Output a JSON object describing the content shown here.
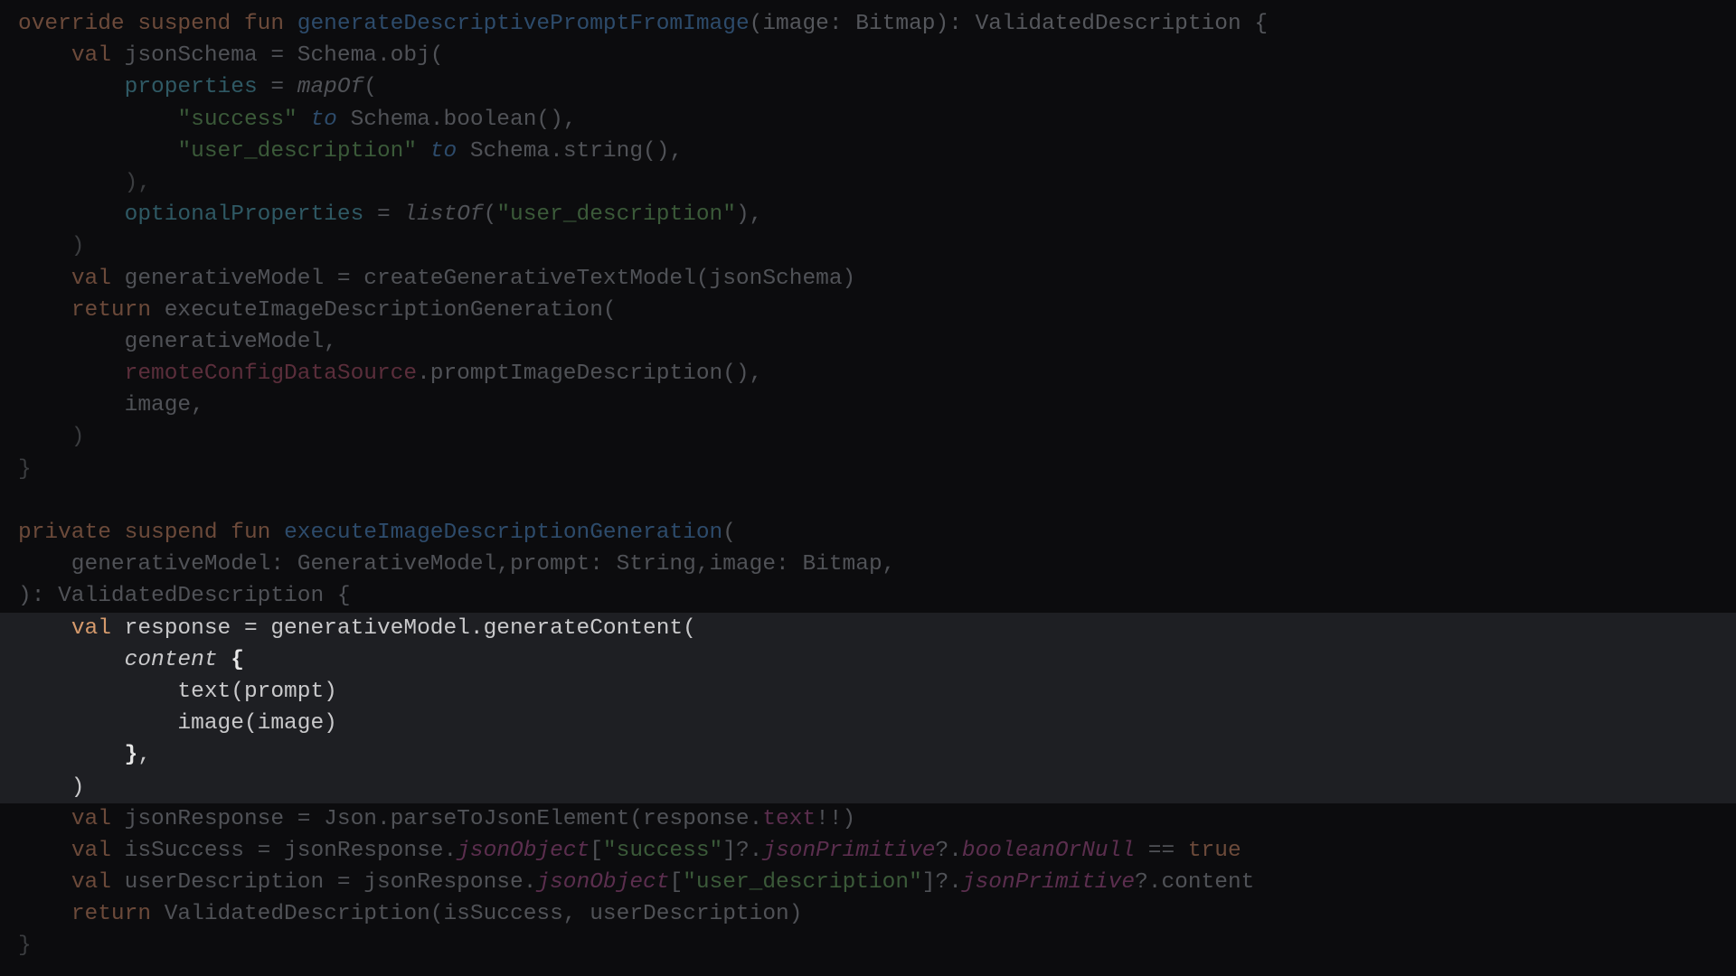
{
  "editor": {
    "lines": [
      {
        "highlighted": false,
        "tokens": [
          {
            "t": "override suspend fun ",
            "c": "kw"
          },
          {
            "t": "generateDescriptivePromptFromImage",
            "c": "fn"
          },
          {
            "t": "(image: Bitmap): ValidatedDescription {",
            "c": "tp"
          }
        ]
      },
      {
        "highlighted": false,
        "tokens": [
          {
            "t": "    ",
            "c": "plain"
          },
          {
            "t": "val ",
            "c": "kw"
          },
          {
            "t": "jsonSchema = Schema.obj(",
            "c": "plain"
          }
        ]
      },
      {
        "highlighted": false,
        "tokens": [
          {
            "t": "        ",
            "c": "plain"
          },
          {
            "t": "properties",
            "c": "pr"
          },
          {
            "t": " = ",
            "c": "plain"
          },
          {
            "t": "mapOf",
            "c": "plain it"
          },
          {
            "t": "(",
            "c": "plain"
          }
        ]
      },
      {
        "highlighted": false,
        "tokens": [
          {
            "t": "            ",
            "c": "plain"
          },
          {
            "t": "\"success\"",
            "c": "st"
          },
          {
            "t": " ",
            "c": "plain"
          },
          {
            "t": "to",
            "c": "inf"
          },
          {
            "t": " Schema.boolean(),",
            "c": "plain"
          }
        ]
      },
      {
        "highlighted": false,
        "tokens": [
          {
            "t": "            ",
            "c": "plain"
          },
          {
            "t": "\"user_description\"",
            "c": "st"
          },
          {
            "t": " ",
            "c": "plain"
          },
          {
            "t": "to",
            "c": "inf"
          },
          {
            "t": " Schema.string(),",
            "c": "plain"
          }
        ]
      },
      {
        "highlighted": false,
        "tokens": [
          {
            "t": "        ),",
            "c": "dim"
          }
        ]
      },
      {
        "highlighted": false,
        "tokens": [
          {
            "t": "        ",
            "c": "plain"
          },
          {
            "t": "optionalProperties",
            "c": "pr"
          },
          {
            "t": " = ",
            "c": "plain"
          },
          {
            "t": "listOf",
            "c": "plain it"
          },
          {
            "t": "(",
            "c": "plain"
          },
          {
            "t": "\"user_description\"",
            "c": "st"
          },
          {
            "t": "),",
            "c": "plain"
          }
        ]
      },
      {
        "highlighted": false,
        "tokens": [
          {
            "t": "    )",
            "c": "dim"
          }
        ]
      },
      {
        "highlighted": false,
        "tokens": [
          {
            "t": "    ",
            "c": "plain"
          },
          {
            "t": "val ",
            "c": "kw"
          },
          {
            "t": "generativeModel = createGenerativeTextModel(jsonSchema)",
            "c": "plain"
          }
        ]
      },
      {
        "highlighted": false,
        "tokens": [
          {
            "t": "    ",
            "c": "plain"
          },
          {
            "t": "return ",
            "c": "kw"
          },
          {
            "t": "executeImageDescriptionGeneration(",
            "c": "plain"
          }
        ]
      },
      {
        "highlighted": false,
        "tokens": [
          {
            "t": "        generativeModel,",
            "c": "plain"
          }
        ]
      },
      {
        "highlighted": false,
        "tokens": [
          {
            "t": "        ",
            "c": "plain"
          },
          {
            "t": "remoteConfigDataSource",
            "c": "rc"
          },
          {
            "t": ".promptImageDescription(),",
            "c": "plain"
          }
        ]
      },
      {
        "highlighted": false,
        "tokens": [
          {
            "t": "        image,",
            "c": "plain"
          }
        ]
      },
      {
        "highlighted": false,
        "tokens": [
          {
            "t": "    )",
            "c": "dim"
          }
        ]
      },
      {
        "highlighted": false,
        "tokens": [
          {
            "t": "}",
            "c": "dim"
          }
        ]
      },
      {
        "highlighted": false,
        "tokens": [
          {
            "t": "",
            "c": "plain"
          }
        ]
      },
      {
        "highlighted": false,
        "tokens": [
          {
            "t": "private suspend fun ",
            "c": "kw"
          },
          {
            "t": "executeImageDescriptionGeneration",
            "c": "fn"
          },
          {
            "t": "(",
            "c": "plain"
          }
        ]
      },
      {
        "highlighted": false,
        "tokens": [
          {
            "t": "    generativeModel: GenerativeModel,prompt: String,image: Bitmap,",
            "c": "plain"
          }
        ]
      },
      {
        "highlighted": false,
        "tokens": [
          {
            "t": "): ValidatedDescription {",
            "c": "plain"
          }
        ]
      },
      {
        "highlighted": true,
        "tokens": [
          {
            "t": "    ",
            "c": "plain"
          },
          {
            "t": "val ",
            "c": "kw"
          },
          {
            "t": "response = generativeModel.generateContent(",
            "c": "plain"
          }
        ]
      },
      {
        "highlighted": true,
        "tokens": [
          {
            "t": "        ",
            "c": "plain"
          },
          {
            "t": "content",
            "c": "it"
          },
          {
            "t": " ",
            "c": "plain"
          },
          {
            "t": "{",
            "c": "br"
          }
        ]
      },
      {
        "highlighted": true,
        "tokens": [
          {
            "t": "            text(prompt)",
            "c": "plain"
          }
        ]
      },
      {
        "highlighted": true,
        "tokens": [
          {
            "t": "            image(image)",
            "c": "plain"
          }
        ]
      },
      {
        "highlighted": true,
        "tokens": [
          {
            "t": "        ",
            "c": "plain"
          },
          {
            "t": "}",
            "c": "br"
          },
          {
            "t": ",",
            "c": "plain"
          }
        ]
      },
      {
        "highlighted": true,
        "tokens": [
          {
            "t": "    )",
            "c": "plain"
          }
        ]
      },
      {
        "highlighted": false,
        "tokens": [
          {
            "t": "    ",
            "c": "plain"
          },
          {
            "t": "val ",
            "c": "kw"
          },
          {
            "t": "jsonResponse = Json.parseToJsonElement(response.",
            "c": "plain"
          },
          {
            "t": "text",
            "c": "ptext"
          },
          {
            "t": "!!)",
            "c": "plain"
          }
        ]
      },
      {
        "highlighted": false,
        "tokens": [
          {
            "t": "    ",
            "c": "plain"
          },
          {
            "t": "val ",
            "c": "kw"
          },
          {
            "t": "isSuccess = jsonResponse.",
            "c": "plain"
          },
          {
            "t": "jsonObject",
            "c": "ext"
          },
          {
            "t": "[",
            "c": "plain"
          },
          {
            "t": "\"success\"",
            "c": "st"
          },
          {
            "t": "]?.",
            "c": "plain"
          },
          {
            "t": "jsonPrimitive",
            "c": "ext"
          },
          {
            "t": "?.",
            "c": "plain"
          },
          {
            "t": "booleanOrNull",
            "c": "ext"
          },
          {
            "t": " == ",
            "c": "plain"
          },
          {
            "t": "true",
            "c": "kw"
          }
        ]
      },
      {
        "highlighted": false,
        "tokens": [
          {
            "t": "    ",
            "c": "plain"
          },
          {
            "t": "val ",
            "c": "kw"
          },
          {
            "t": "userDescription = jsonResponse.",
            "c": "plain"
          },
          {
            "t": "jsonObject",
            "c": "ext"
          },
          {
            "t": "[",
            "c": "plain"
          },
          {
            "t": "\"user_description\"",
            "c": "st"
          },
          {
            "t": "]?.",
            "c": "plain"
          },
          {
            "t": "jsonPrimitive",
            "c": "ext"
          },
          {
            "t": "?.content",
            "c": "plain"
          }
        ]
      },
      {
        "highlighted": false,
        "tokens": [
          {
            "t": "    ",
            "c": "plain"
          },
          {
            "t": "return ",
            "c": "kw"
          },
          {
            "t": "ValidatedDescription(isSuccess, userDescription)",
            "c": "plain"
          }
        ]
      },
      {
        "highlighted": false,
        "tokens": [
          {
            "t": "}",
            "c": "dim"
          }
        ]
      }
    ]
  },
  "colors": {
    "background": "#0c0c0e",
    "highlight_background": "#1e1f23",
    "keyword": "#d59a6c",
    "text": "#c9c9cb"
  }
}
